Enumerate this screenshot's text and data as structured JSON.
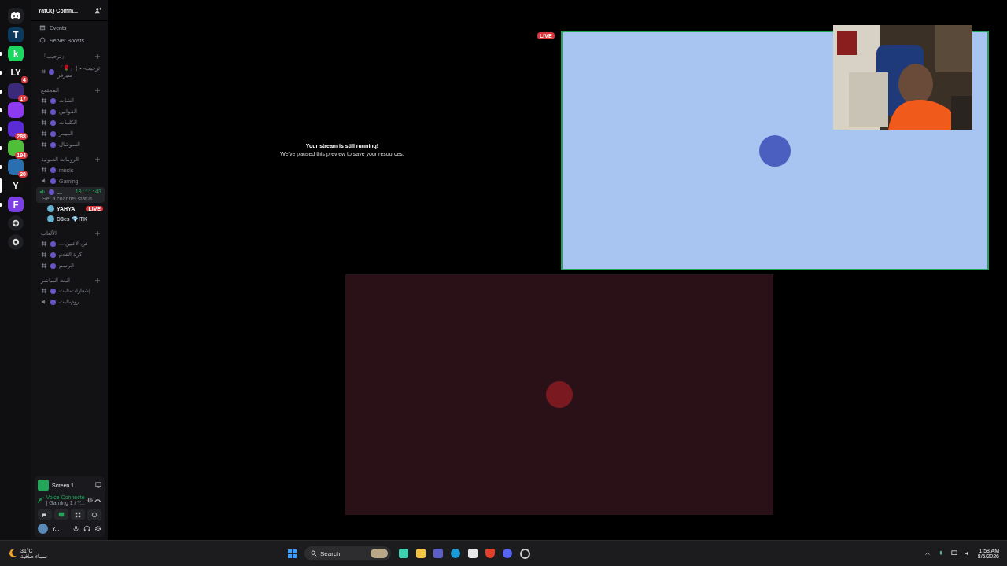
{
  "servers": [
    {
      "color": "#0b3a5c",
      "label": "T",
      "unread": false,
      "selected": false
    },
    {
      "color": "#1ed760",
      "label": "k",
      "unread": true,
      "selected": false
    },
    {
      "color": "#111111",
      "label": "LY",
      "badge": "4",
      "unread": true,
      "selected": false
    },
    {
      "color": "#3b2a7a",
      "badge": "17",
      "unread": true,
      "selected": false
    },
    {
      "color": "#8e3bf0",
      "unread": true,
      "selected": false
    },
    {
      "color": "#5b2bd6",
      "badge": "288",
      "unread": true,
      "selected": false
    },
    {
      "color": "#4fbf3a",
      "badge": "194",
      "unread": true,
      "selected": false
    },
    {
      "color": "#2a6fb0",
      "badge": "30",
      "unread": true,
      "selected": false
    },
    {
      "color": "#111111",
      "label": "Y",
      "unread": false,
      "selected": true
    },
    {
      "color": "#7b3fe4",
      "label": "F",
      "unread": true,
      "selected": false
    }
  ],
  "server_header": {
    "title": "YatOQ Comm..."
  },
  "menu_items": [
    {
      "kind": "events",
      "label": "Events"
    },
    {
      "kind": "boosts",
      "label": "Server Boosts"
    }
  ],
  "categories": [
    {
      "name": "『ترحيب』",
      "channels": [
        {
          "kind": "text",
          "name": "『🌹』⟨ • ترحيب-سيرفر"
        }
      ]
    },
    {
      "name": "المجتمع",
      "channels": [
        {
          "kind": "text",
          "name": "الشات"
        },
        {
          "kind": "text",
          "name": "القوانين"
        },
        {
          "kind": "text",
          "name": "الكلمات"
        },
        {
          "kind": "text",
          "name": "الميمز"
        },
        {
          "kind": "text",
          "name": "السوشال"
        }
      ]
    },
    {
      "name": "الرومات الصوتية",
      "channels": [
        {
          "kind": "text",
          "name": "music"
        },
        {
          "kind": "voice",
          "name": "Gaming"
        },
        {
          "kind": "active-voice",
          "name": "...",
          "timer": "10:11:43",
          "status": "Set a channel status",
          "users": [
            {
              "name": "YAHYA",
              "live": true,
              "badge": "LIVE"
            },
            {
              "name": "D8es 💎ITK",
              "live": false
            }
          ]
        }
      ]
    },
    {
      "name": "الألعاب",
      "channels": [
        {
          "kind": "text",
          "name": "...-عن-لاعبين"
        },
        {
          "kind": "text",
          "name": "كرة-القدم"
        },
        {
          "kind": "text",
          "name": "الرسم"
        }
      ]
    },
    {
      "name": "البث المباشر",
      "channels": [
        {
          "kind": "text",
          "name": "إشعارات-البث"
        },
        {
          "kind": "voice",
          "name": "روم-البث"
        }
      ]
    }
  ],
  "stream_panel": {
    "title": "Screen 1"
  },
  "voice_panel": {
    "status": "Voice Connecte",
    "channel": "| Gaming 1 / Y..."
  },
  "user_panel": {
    "name": "Y..."
  },
  "stage": {
    "paused_title": "Your stream is still running!",
    "paused_text": "We've paused this preview to save your resources.",
    "live_badge": "LIVE"
  },
  "taskbar": {
    "temperature": "31°C",
    "weather": "سماء صافية",
    "search_placeholder": "Search",
    "time": "1:58 AM",
    "date": "8/5/2026"
  }
}
